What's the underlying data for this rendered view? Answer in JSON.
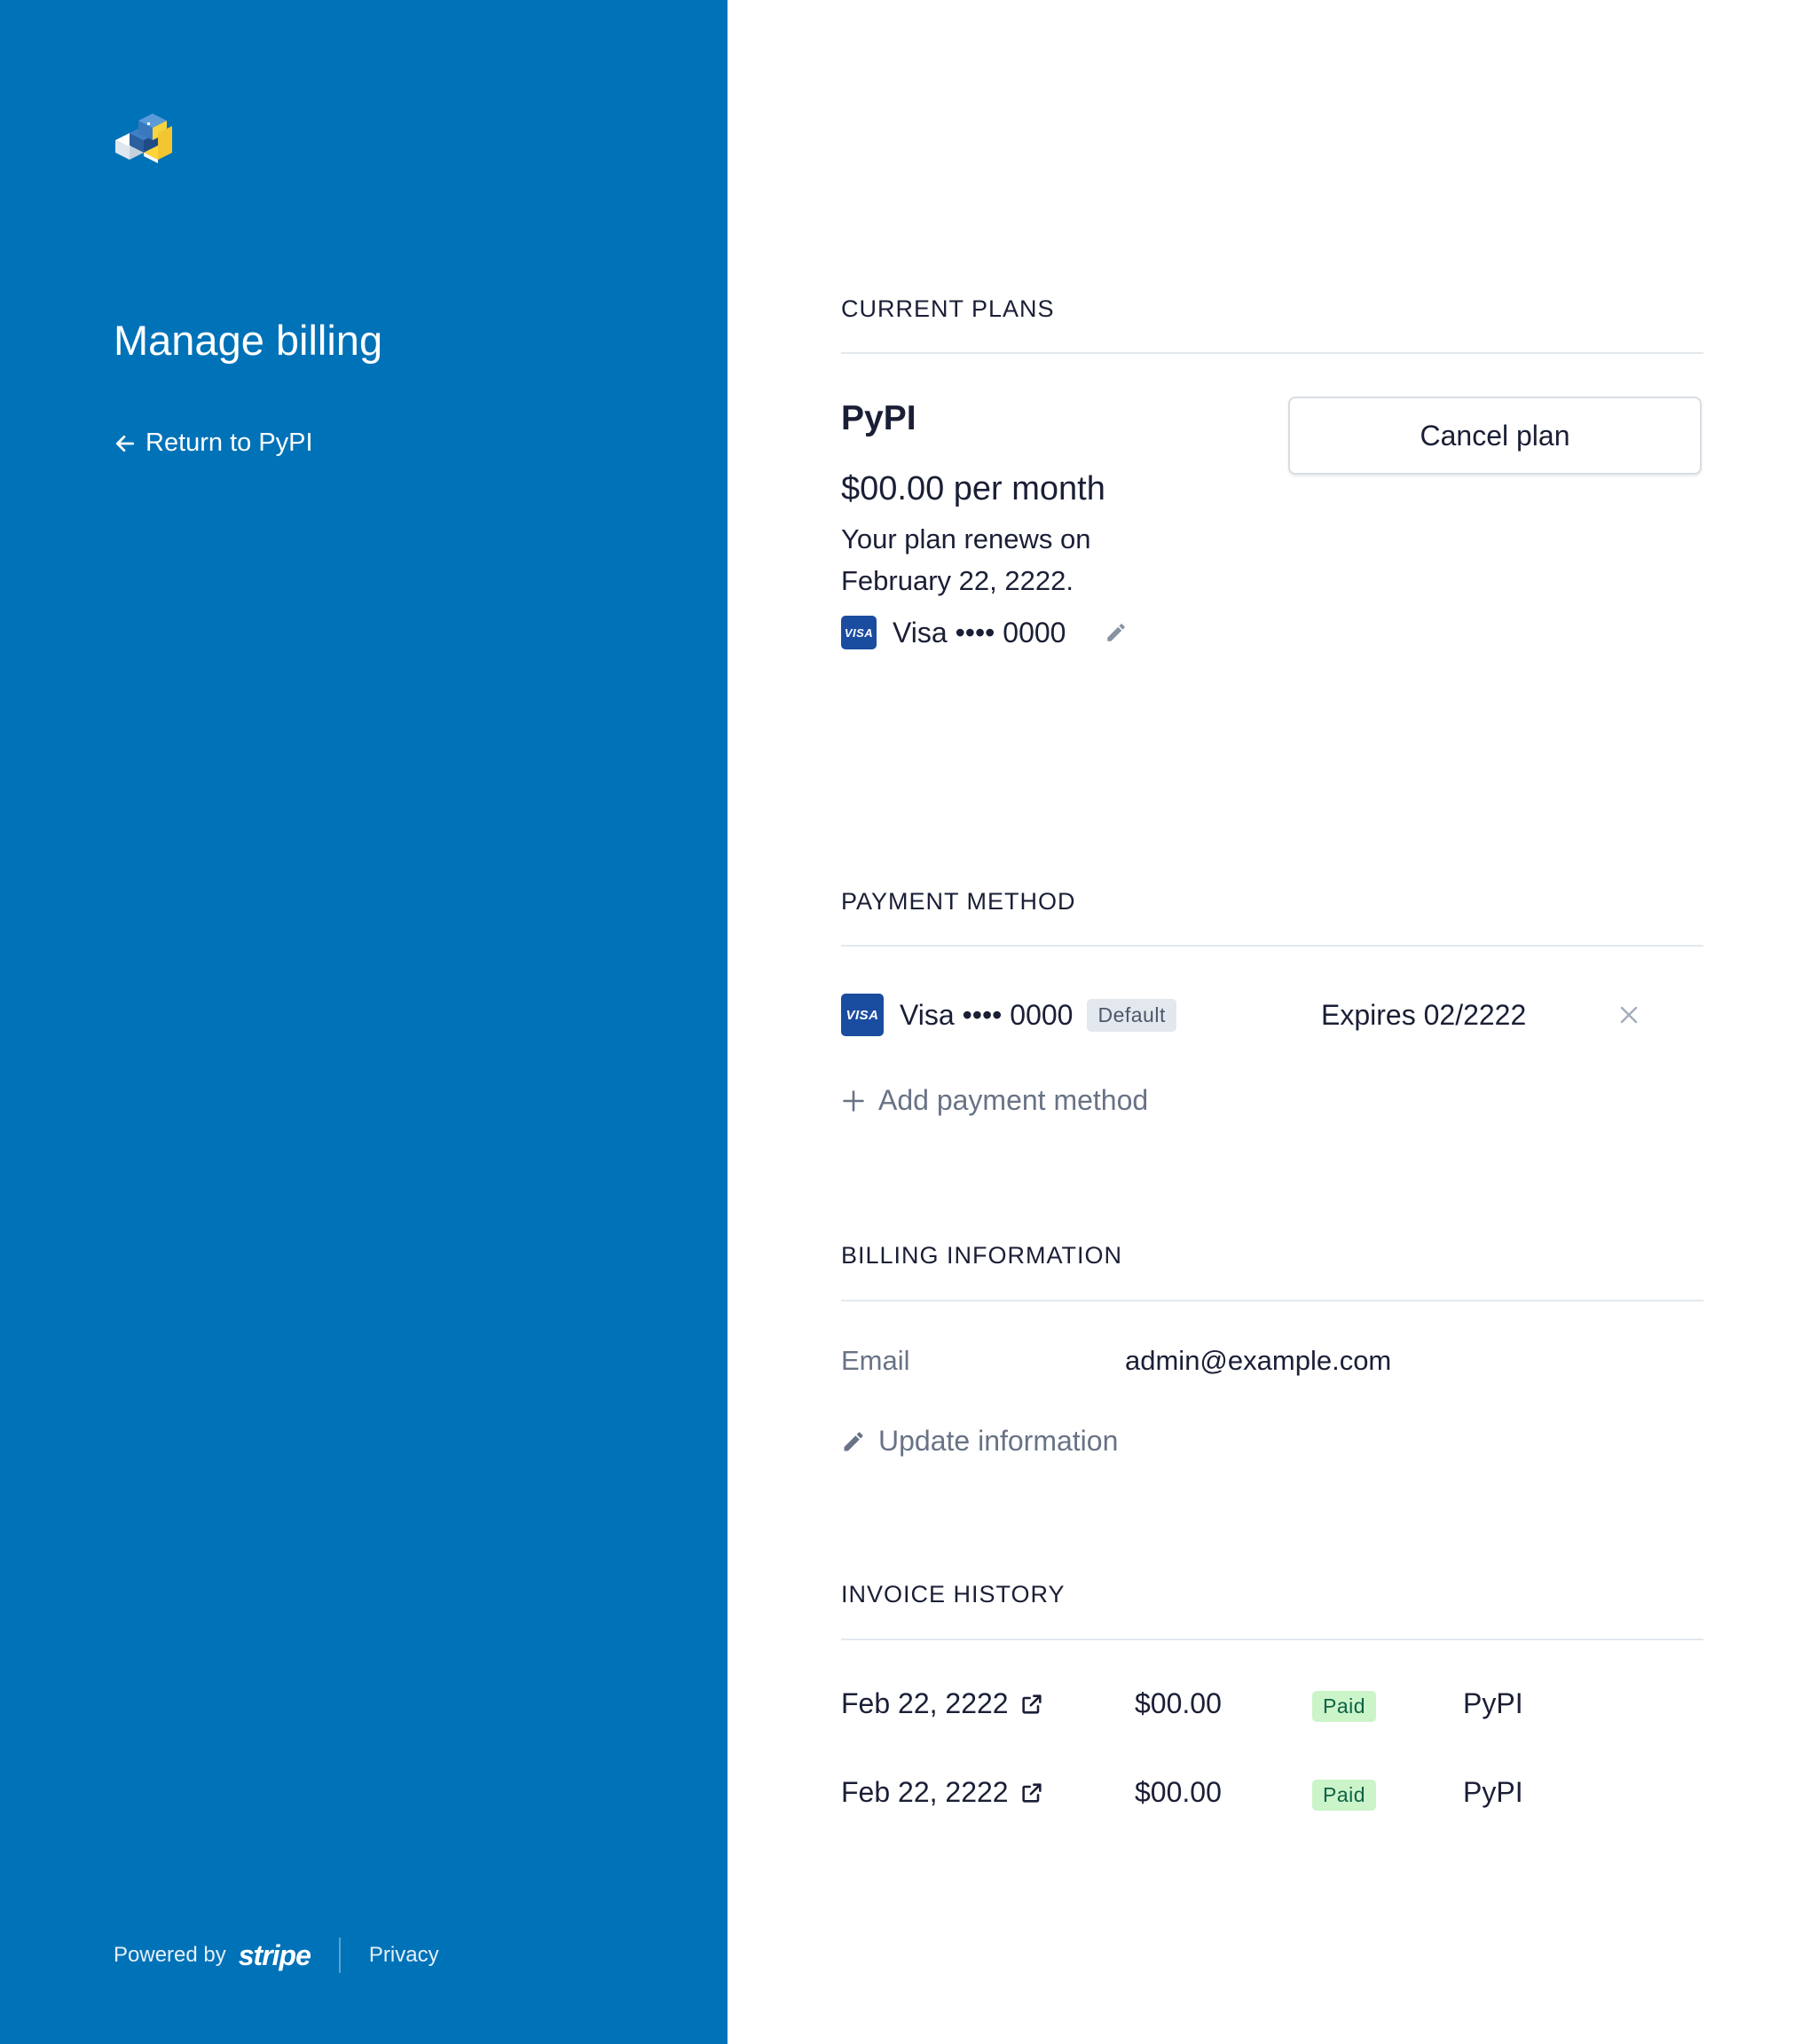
{
  "sidebar": {
    "title": "Manage billing",
    "return_link": "Return to PyPI",
    "footer": {
      "powered_by": "Powered by",
      "brand": "stripe",
      "privacy": "Privacy"
    }
  },
  "current_plans": {
    "heading": "CURRENT PLANS",
    "plan_name": "PyPI",
    "price": "$00.00 per month",
    "renewal": "Your plan renews on February 22, 2222.",
    "card_brand_badge": "VISA",
    "card": "Visa •••• 0000",
    "cancel_button": "Cancel plan"
  },
  "payment_method": {
    "heading": "PAYMENT METHOD",
    "card_brand_badge": "VISA",
    "card": "Visa •••• 0000",
    "default_badge": "Default",
    "expires": "Expires 02/2222",
    "add_label": "Add payment method"
  },
  "billing_information": {
    "heading": "BILLING INFORMATION",
    "email_label": "Email",
    "email_value": "admin@example.com",
    "update_label": "Update information"
  },
  "invoice_history": {
    "heading": "INVOICE HISTORY",
    "rows": [
      {
        "date": "Feb 22, 2222",
        "amount": "$00.00",
        "status": "Paid",
        "plan": "PyPI"
      },
      {
        "date": "Feb 22, 2222",
        "amount": "$00.00",
        "status": "Paid",
        "plan": "PyPI"
      }
    ]
  },
  "colors": {
    "sidebar_bg": "#0072b8",
    "text_primary": "#1a1f36",
    "text_secondary": "#697386",
    "paid_badge_bg": "#cbf4c9",
    "paid_badge_text": "#0e6245",
    "visa_blue": "#1a4ca0"
  },
  "icons": [
    "pypi-logo",
    "arrow-left-icon",
    "visa-icon",
    "pencil-icon",
    "close-icon",
    "plus-icon",
    "external-link-icon"
  ]
}
